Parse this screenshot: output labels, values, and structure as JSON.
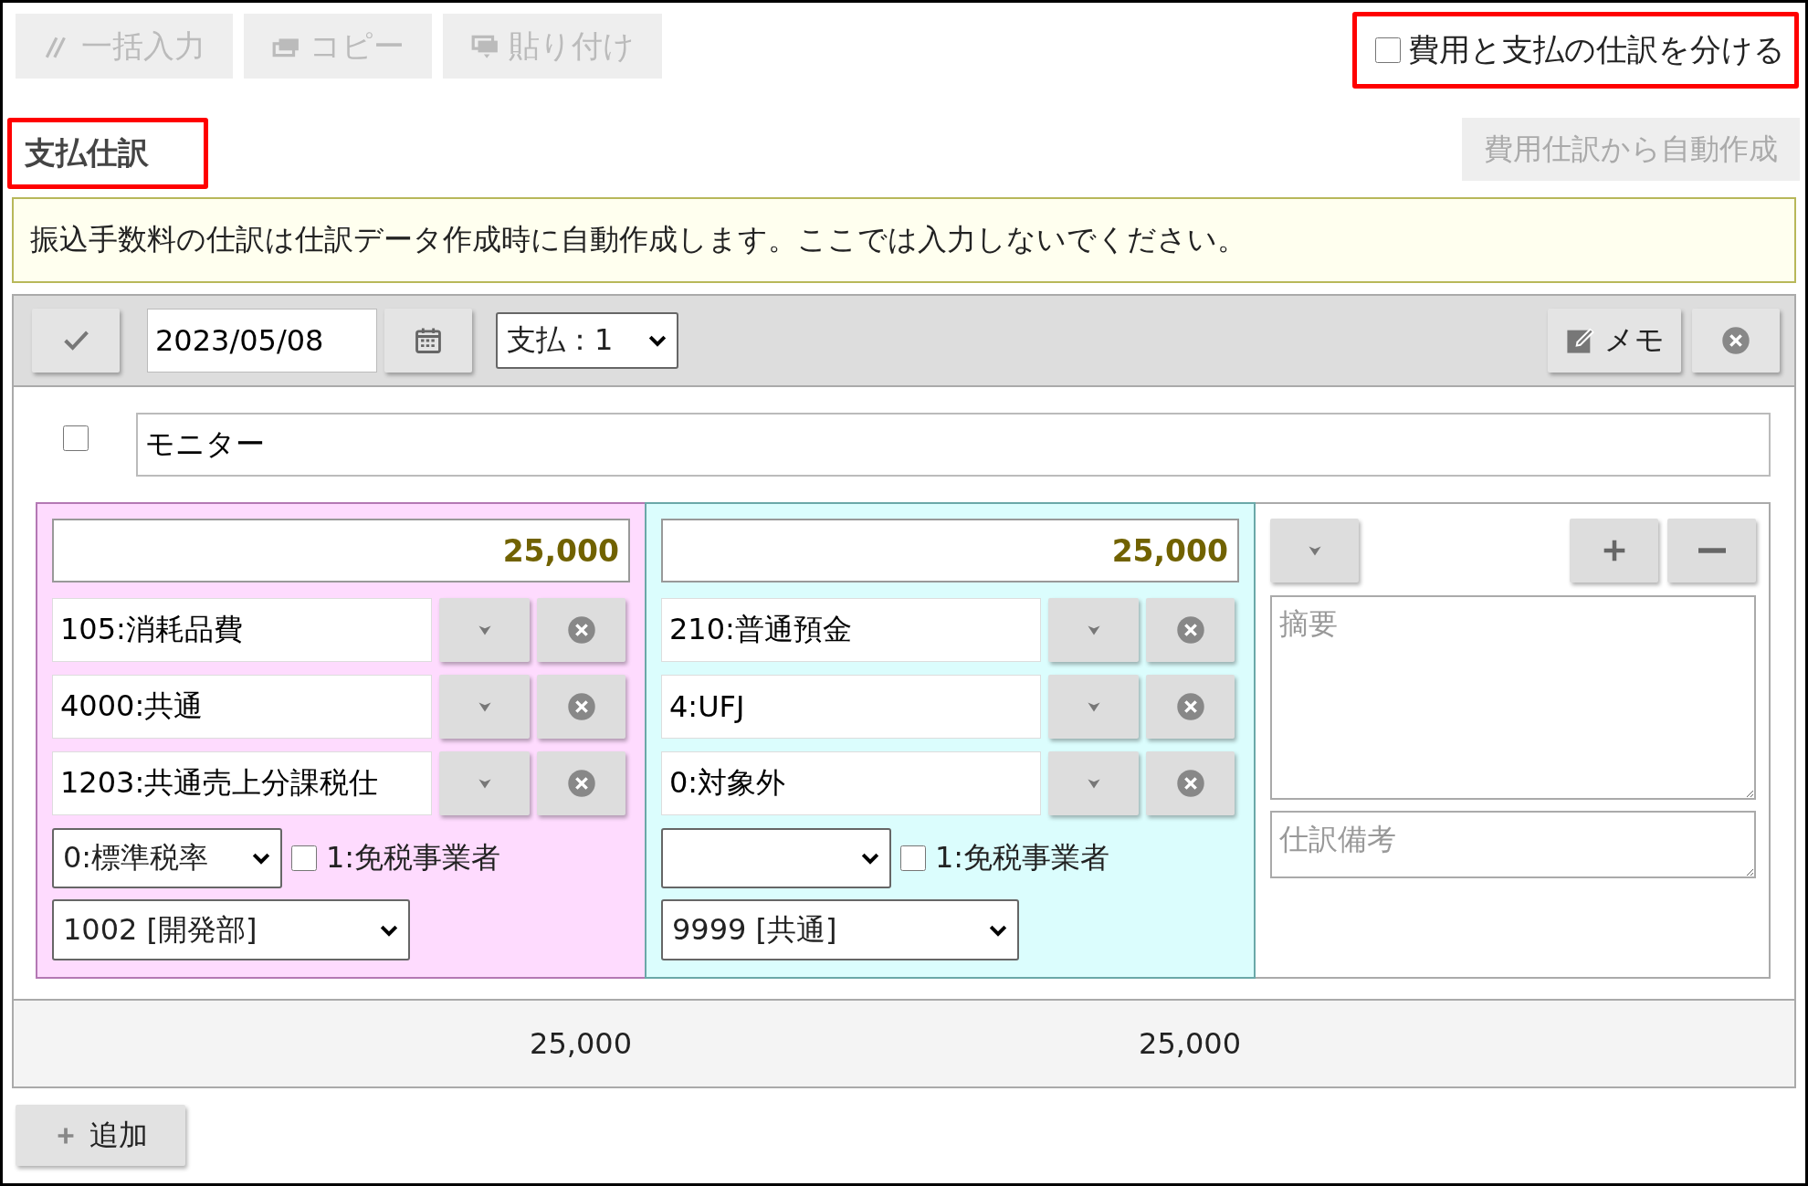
{
  "toolbar": {
    "buttons": [
      {
        "kind": "bulk",
        "label": "一括入力",
        "disabled": true
      },
      {
        "kind": "copy",
        "label": "コピー",
        "disabled": true
      },
      {
        "kind": "paste",
        "label": "貼り付け",
        "disabled": true
      }
    ]
  },
  "split_option": {
    "label": "費用と支払の仕訳を分ける",
    "checked": false,
    "highlighted": true
  },
  "section": {
    "title": "支払仕訳",
    "highlighted": true,
    "auto_button": {
      "label": "費用仕訳から自動作成",
      "disabled": true
    }
  },
  "notice": "振込手数料の仕訳は仕訳データ作成時に自動作成します。ここでは入力しないでください。",
  "entry": {
    "date": "2023/05/08",
    "type_select": "支払：1",
    "memo_button": "メモ",
    "checked": false,
    "description": "モニター",
    "columns": [
      {
        "kind": "debit",
        "amount": "25,000",
        "fields": [
          "105:消耗品費",
          "4000:共通",
          "1203:共通売上分課税仕"
        ],
        "tax_rate": "0:標準税率",
        "exempt": {
          "label": "1:免税事業者",
          "checked": false
        },
        "department": "1002 [開発部]"
      },
      {
        "kind": "credit",
        "amount": "25,000",
        "fields": [
          "210:普通預金",
          "4:UFJ",
          "0:対象外"
        ],
        "exempt": {
          "label": "1:免税事業者",
          "checked": false
        },
        "department": "9999 [共通]"
      }
    ],
    "summary_placeholder": "摘要",
    "note_placeholder": "仕訳備考"
  },
  "totals": [
    "25,000",
    "25,000"
  ],
  "add_button": "追加"
}
